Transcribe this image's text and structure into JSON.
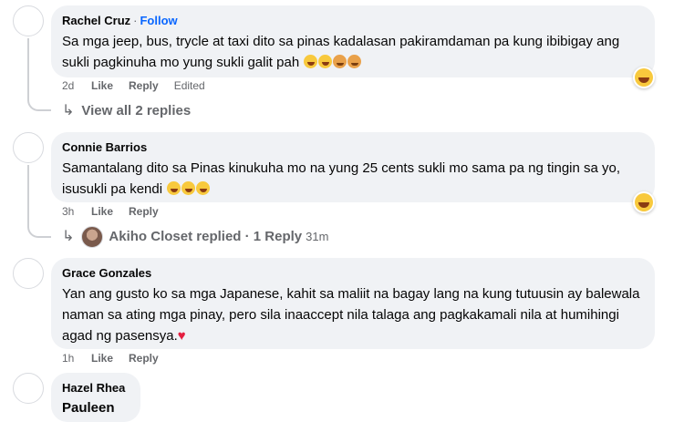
{
  "comments": [
    {
      "author": "Rachel Cruz",
      "follow_label": "Follow",
      "text": "Sa mga jeep, bus, trycle at taxi dito sa pinas kadalasan pakiramdaman pa kung ibibigay ang sukli pagkinuha mo yung sukli galit pah",
      "emojis": [
        "laughing-face",
        "laughing-face",
        "person-facepalming",
        "person-facepalming"
      ],
      "time": "2d",
      "like_label": "Like",
      "reply_label": "Reply",
      "edited_label": "Edited",
      "reaction": "haha",
      "replies": {
        "label": "View all 2 replies"
      }
    },
    {
      "author": "Connie Barrios",
      "text": "Samantalang dito sa Pinas kinukuha mo na yung 25 cents sukli mo sama pa ng tingin sa yo, isusukli pa kendi",
      "emojis": [
        "rolling-laughing-face",
        "rolling-laughing-face",
        "rolling-laughing-face"
      ],
      "time": "3h",
      "like_label": "Like",
      "reply_label": "Reply",
      "reaction": "haha",
      "replies": {
        "replier": "Akiho Closet",
        "label": "replied · 1 Reply",
        "time": "31m"
      }
    },
    {
      "author": "Grace Gonzales",
      "text": "Yan ang gusto ko sa mga Japanese, kahit sa maliit na bagay lang na kung tutuusin ay balewala naman sa ating mga pinay, pero sila inaaccept nila talaga ang pagkakamali nila at humihingi agad ng pasensya.",
      "emojis": [
        "red-heart"
      ],
      "time": "1h",
      "like_label": "Like",
      "reply_label": "Reply"
    },
    {
      "author": "Hazel Rhea",
      "text": "Pauleen"
    }
  ],
  "colors": {
    "bubble": "#f0f2f5",
    "link": "#0866ff",
    "muted": "#65676b",
    "heart": "#e41e3f"
  }
}
